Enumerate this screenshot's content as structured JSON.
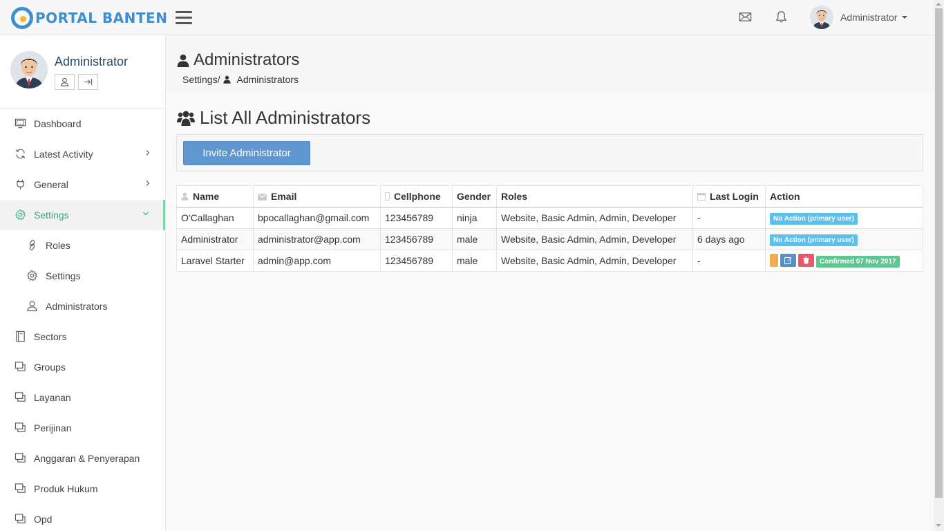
{
  "brand": {
    "name": "PORTAL BANTEN"
  },
  "header": {
    "user_name": "Administrator",
    "icons": [
      "hamburger-icon",
      "envelope-icon",
      "bell-icon"
    ]
  },
  "sidebar": {
    "profile_name": "Administrator",
    "items": [
      {
        "label": "Dashboard",
        "icon": "monitor-icon"
      },
      {
        "label": "Latest Activity",
        "icon": "refresh-icon"
      },
      {
        "label": "General",
        "icon": "plug-icon"
      },
      {
        "label": "Settings",
        "icon": "gear-icon",
        "active": true
      },
      {
        "label": "Roles",
        "icon": "link-icon"
      },
      {
        "label": "Settings",
        "icon": "gear-icon"
      },
      {
        "label": "Administrators",
        "icon": "user-icon"
      },
      {
        "label": "Sectors",
        "icon": "book-icon"
      },
      {
        "label": "Groups",
        "icon": "window-icon"
      },
      {
        "label": "Layanan",
        "icon": "window-icon"
      },
      {
        "label": "Perijinan",
        "icon": "window-icon"
      },
      {
        "label": "Anggaran & Penyerapan",
        "icon": "window-icon"
      },
      {
        "label": "Produk Hukum",
        "icon": "window-icon"
      },
      {
        "label": "Opd",
        "icon": "window-icon"
      }
    ]
  },
  "page": {
    "title": "Administrators",
    "breadcrumb_parent": "Settings/",
    "breadcrumb_current": "Administrators",
    "section_title": "List All Administrators",
    "invite_button": "Invite Administrator"
  },
  "table": {
    "headers": [
      "Name",
      "Email",
      "Cellphone",
      "Gender",
      "Roles",
      "Last Login",
      "Action"
    ],
    "rows": [
      {
        "name": "O'Callaghan",
        "email": "bpocallaghan@gmail.com",
        "cellphone": "123456789",
        "gender": "ninja",
        "roles": "Website, Basic Admin, Admin, Developer",
        "last_login": "-",
        "action_badge": "No Action (primary user)"
      },
      {
        "name": "Administrator",
        "email": "administrator@app.com",
        "cellphone": "123456789",
        "gender": "male",
        "roles": "Website, Basic Admin, Admin, Developer",
        "last_login": "6 days ago",
        "action_badge": "No Action (primary user)"
      },
      {
        "name": "Laravel Starter",
        "email": "admin@app.com",
        "cellphone": "123456789",
        "gender": "male",
        "roles": "Website, Basic Admin, Admin, Developer",
        "last_login": "-",
        "action_badge": "Confirmed 07 Nov 2017"
      }
    ]
  },
  "colors": {
    "brand": "#3f8ecf",
    "active_menu": "#39a97b",
    "primary_button": "#6197d0",
    "badge_info": "#5bc0eb",
    "badge_success": "#5cc78e",
    "danger": "#e9596a",
    "warning": "#f0ad4e"
  }
}
